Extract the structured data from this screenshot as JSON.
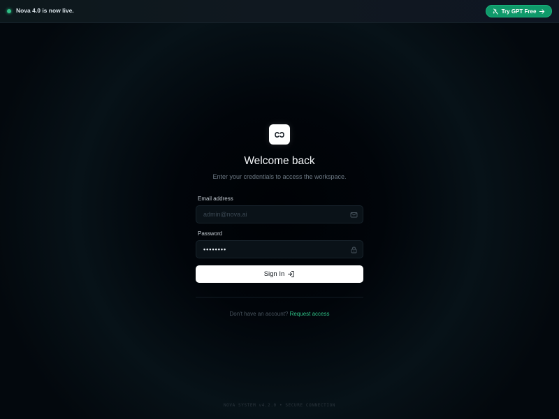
{
  "banner": {
    "status_text": "Nova 4.0 is now live.",
    "cta_label": "Try GPT Free",
    "cta_icon": "sparkle-slash-icon",
    "cta_arrow_icon": "arrow-right-icon",
    "status_color": "#2fbf85",
    "cta_color": "#0f9a6a"
  },
  "login": {
    "logo_icon": "infinity-link-icon",
    "title": "Welcome back",
    "subtitle": "Enter your credentials to access the workspace.",
    "email_label": "Email address",
    "email_placeholder": "admin@nova.ai",
    "email_icon": "mail-icon",
    "password_label": "Password",
    "password_value": "••••••••",
    "password_icon": "lock-icon",
    "submit_label": "Sign In",
    "submit_icon": "log-in-icon",
    "no_account_text": "Don't have an account?",
    "request_link": "Request access",
    "link_color": "#2fbf85"
  },
  "footer": {
    "version_text": "NOVA SYSTEM v4.2.0 • SECURE CONNECTION"
  }
}
